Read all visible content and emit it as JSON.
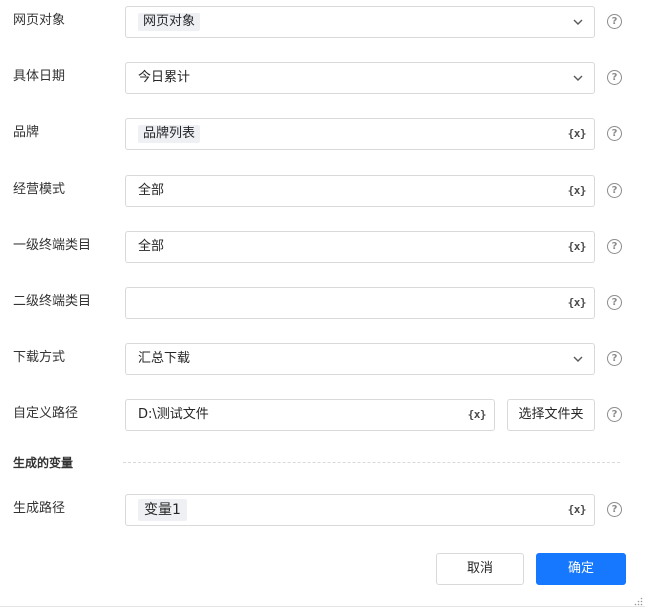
{
  "fields": [
    {
      "label": "网页对象",
      "value": "网页对象",
      "kind": "select-tag",
      "icon": "chevron-down-icon"
    },
    {
      "label": "具体日期",
      "value": "今日累计",
      "kind": "select",
      "icon": "chevron-down-icon"
    },
    {
      "label": "品牌",
      "value": "品牌列表",
      "kind": "var-tag",
      "icon": "variable-icon"
    },
    {
      "label": "经营模式",
      "value": "全部",
      "kind": "var",
      "icon": "variable-icon"
    },
    {
      "label": "一级终端类目",
      "value": "全部",
      "kind": "var",
      "icon": "variable-icon"
    },
    {
      "label": "二级终端类目",
      "value": "",
      "kind": "var",
      "icon": "variable-icon"
    },
    {
      "label": "下载方式",
      "value": "汇总下载",
      "kind": "select",
      "icon": "chevron-down-icon"
    },
    {
      "label": "自定义路径",
      "value": "D:\\测试文件",
      "kind": "var",
      "icon": "variable-icon"
    }
  ],
  "variable_icon_text": "{x}",
  "help_icon_text": "?",
  "select_folder_label": "选择文件夹",
  "section_title": "生成的变量",
  "output": {
    "label": "生成路径",
    "value": "变量1",
    "icon": "variable-icon"
  },
  "buttons": {
    "cancel": "取消",
    "ok": "确定"
  },
  "colors": {
    "primary": "#1677ff",
    "border": "#d9d9d9",
    "tag_bg": "#eef0f4"
  }
}
